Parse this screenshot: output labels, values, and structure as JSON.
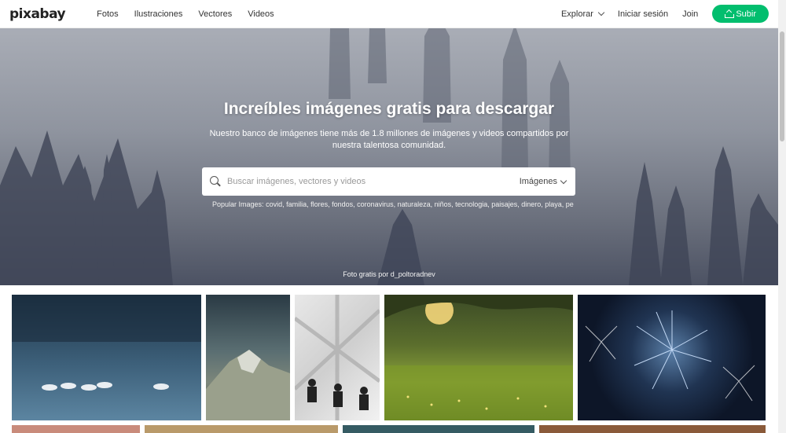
{
  "header": {
    "logo": "pixabay",
    "nav": [
      "Fotos",
      "Ilustraciones",
      "Vectores",
      "Videos"
    ],
    "explore": "Explorar",
    "login": "Iniciar sesión",
    "join": "Join",
    "upload": "Subir"
  },
  "hero": {
    "title": "Increíbles imágenes gratis para descargar",
    "subtitle": "Nuestro banco de imágenes tiene más de 1.8 millones de imágenes y videos compartidos por nuestra talentosa comunidad.",
    "search_placeholder": "Buscar imágenes, vectores y videos",
    "search_type": "Imágenes",
    "popular_label": "Popular Images:",
    "popular_terms": "covid, familia, flores, fondos, coronavirus, naturaleza, niños, tecnologia, paisajes, dinero, playa, perro",
    "credit": "Foto gratis por d_poltoradnev"
  },
  "colors": {
    "accent": "#02be6e"
  }
}
